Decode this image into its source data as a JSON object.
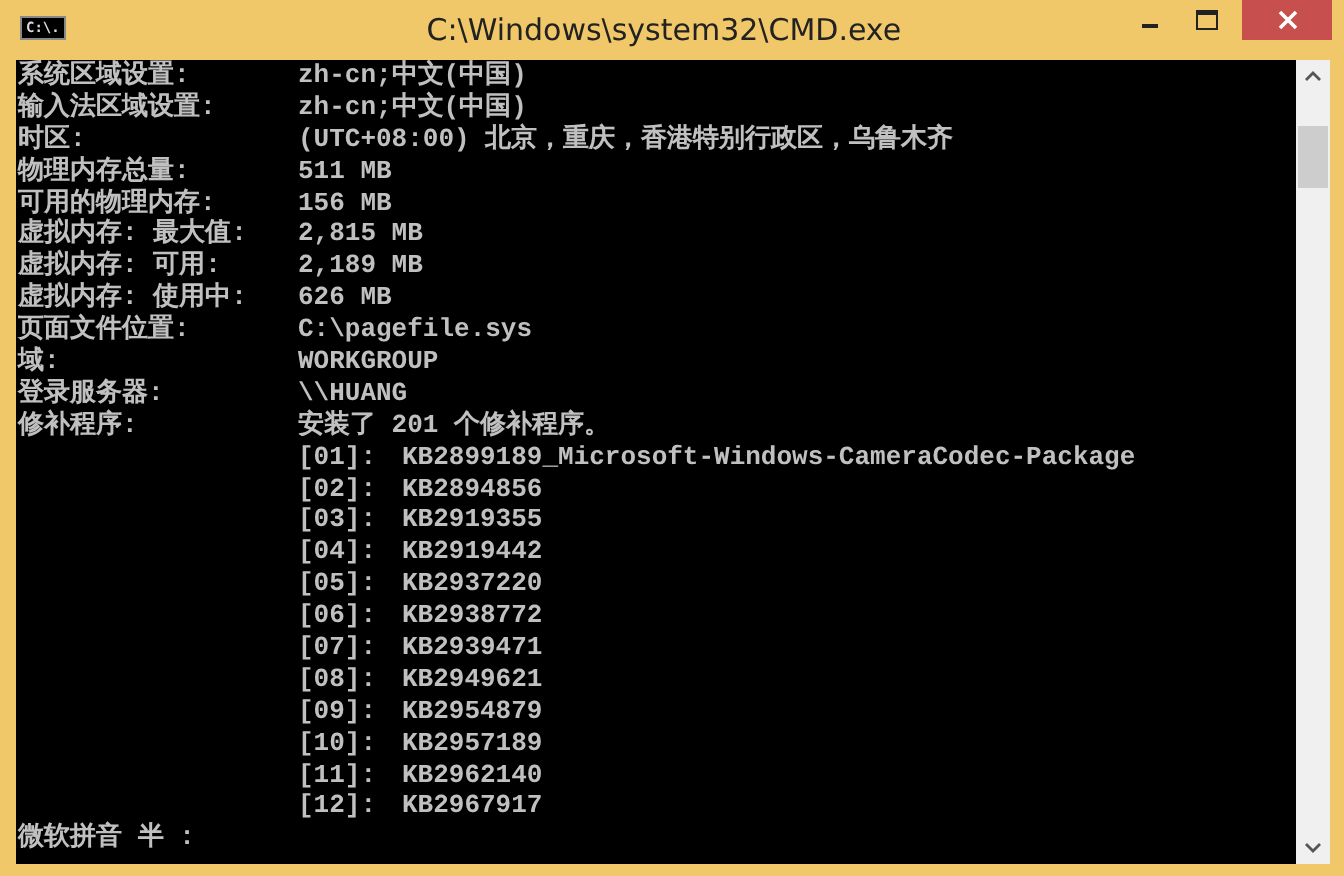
{
  "window": {
    "title": "C:\\Windows\\system32\\CMD.exe",
    "icon_text": "C:\\."
  },
  "info": [
    {
      "label": "系统区域设置:",
      "value": "zh-cn;中文(中国)"
    },
    {
      "label": "输入法区域设置:",
      "value": "zh-cn;中文(中国)"
    },
    {
      "label": "时区:",
      "value": "(UTC+08:00) 北京，重庆，香港特别行政区，乌鲁木齐"
    },
    {
      "label": "物理内存总量:",
      "value": "511 MB"
    },
    {
      "label": "可用的物理内存:",
      "value": "156 MB"
    },
    {
      "label": "虚拟内存: 最大值:",
      "value": "2,815 MB"
    },
    {
      "label": "虚拟内存: 可用:",
      "value": "2,189 MB"
    },
    {
      "label": "虚拟内存: 使用中:",
      "value": "626 MB"
    },
    {
      "label": "页面文件位置:",
      "value": "C:\\pagefile.sys"
    },
    {
      "label": "域:",
      "value": "WORKGROUP"
    },
    {
      "label": "登录服务器:",
      "value": "\\\\HUANG"
    },
    {
      "label": "修补程序:",
      "value": "安装了 201 个修补程序。"
    }
  ],
  "hotfixes": [
    {
      "index": "[01]:",
      "id": "KB2899189_Microsoft-Windows-CameraCodec-Package"
    },
    {
      "index": "[02]:",
      "id": "KB2894856"
    },
    {
      "index": "[03]:",
      "id": "KB2919355"
    },
    {
      "index": "[04]:",
      "id": "KB2919442"
    },
    {
      "index": "[05]:",
      "id": "KB2937220"
    },
    {
      "index": "[06]:",
      "id": "KB2938772"
    },
    {
      "index": "[07]:",
      "id": "KB2939471"
    },
    {
      "index": "[08]:",
      "id": "KB2949621"
    },
    {
      "index": "[09]:",
      "id": "KB2954879"
    },
    {
      "index": "[10]:",
      "id": "KB2957189"
    },
    {
      "index": "[11]:",
      "id": "KB2962140"
    },
    {
      "index": "[12]:",
      "id": "KB2967917"
    }
  ],
  "ime_status": "微软拼音 半 :"
}
